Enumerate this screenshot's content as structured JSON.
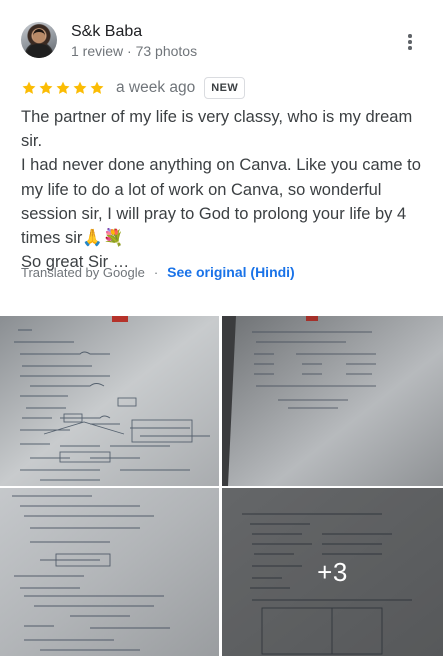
{
  "reviewer": {
    "name": "S&k Baba",
    "meta": "1 review · 73 photos"
  },
  "review": {
    "rating": 5,
    "rating_max": 5,
    "star_color": "#fbbc04",
    "time_ago": "a week ago",
    "badge": "NEW",
    "text_lines": [
      "The partner of my life is very classy, who is my dream sir.",
      "I had never done anything on Canva. Like you came to",
      "my life to do a lot of work on Canva, so wonderful",
      "session sir, I will pray to God to prolong your life by 4",
      "times sir🙏💐",
      "So great Sir …"
    ]
  },
  "translation": {
    "label": "Translated by Google",
    "separator": "·",
    "see_original": "See original (Hindi)",
    "link_color": "#1a73e8"
  },
  "photos": {
    "items": [
      {
        "name": "photo-notes-1",
        "icon": "handwritten-notes"
      },
      {
        "name": "photo-notes-2",
        "icon": "handwritten-notes"
      },
      {
        "name": "photo-notes-3",
        "icon": "handwritten-notes"
      },
      {
        "name": "photo-notes-4",
        "icon": "handwritten-notes"
      }
    ],
    "more_count": "+3"
  }
}
